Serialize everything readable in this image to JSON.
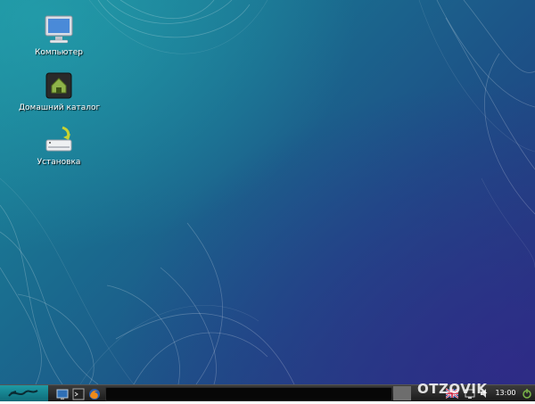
{
  "desktop": {
    "icons": [
      {
        "label": "Компьютер"
      },
      {
        "label": "Домашний каталог"
      },
      {
        "label": "Установка"
      }
    ]
  },
  "taskbar": {
    "clock": "13:00"
  },
  "watermark": {
    "text": "OTZOVIK"
  },
  "colors": {
    "desktop_top": "#1b8c9c",
    "desktop_bottom": "#25327a",
    "taskbar": "#1a1a1a",
    "menu_button": "#1e9aa5"
  },
  "icon_names": [
    "computer-icon",
    "home-folder-icon",
    "install-icon",
    "show-desktop-icon",
    "terminal-icon",
    "firefox-icon",
    "language-flag-icon",
    "network-icon",
    "volume-icon",
    "power-icon"
  ]
}
